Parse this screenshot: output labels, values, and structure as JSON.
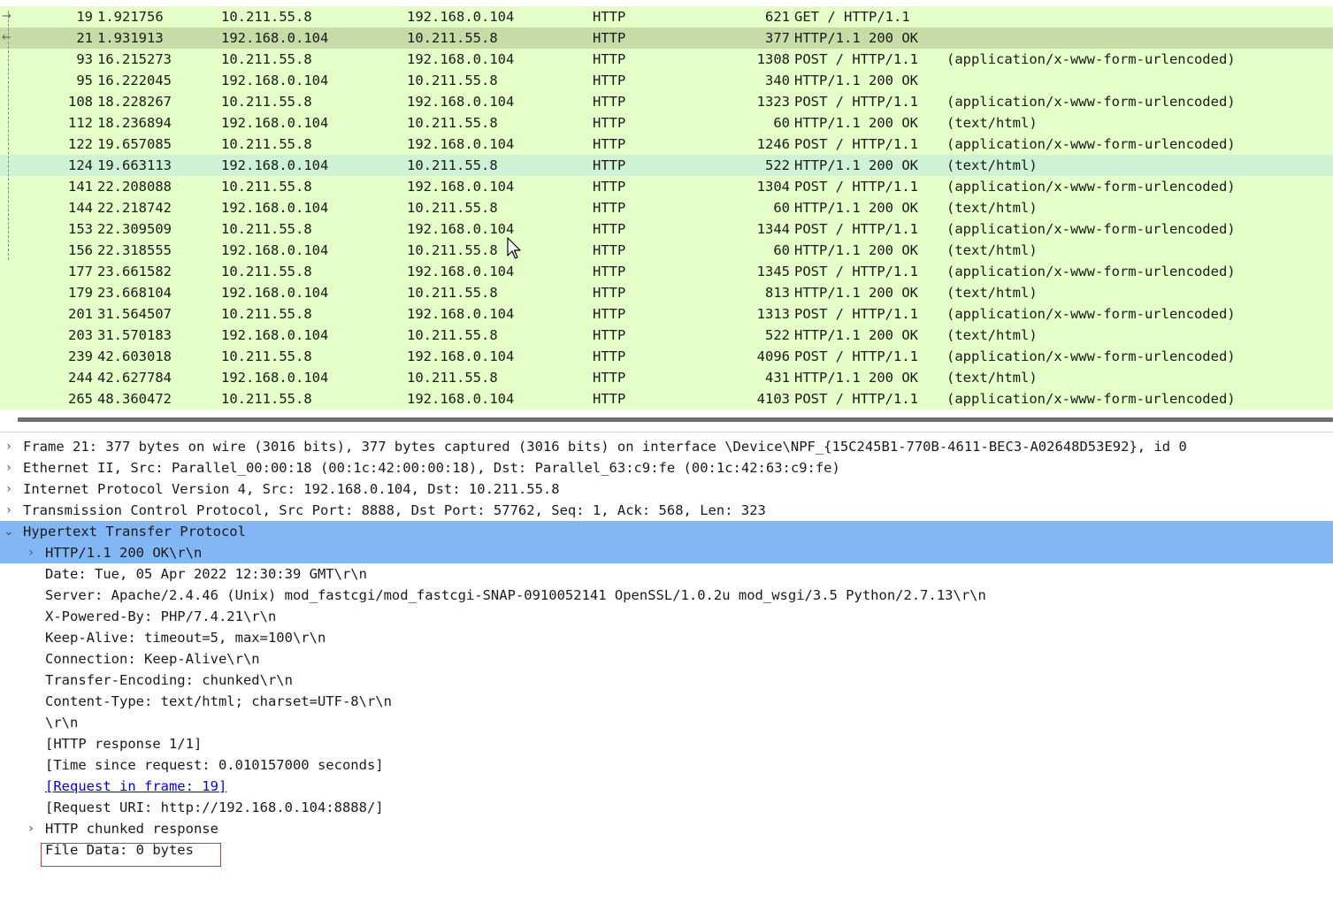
{
  "colors": {
    "row_default": "#e4ffc7",
    "row_selected": "#c6dba6",
    "row_hover": "#cff2d5",
    "detail_selected": "#82b6f4",
    "link": "#0000ee",
    "highlight_box": "#e03030"
  },
  "packet_list": {
    "rows": [
      {
        "no": "19",
        "time": "1.921756",
        "src": "10.211.55.8",
        "dst": "192.168.0.104",
        "proto": "HTTP",
        "len": "621",
        "info": "GET / HTTP/1.1",
        "extra": "",
        "state": "default",
        "arrow": "→"
      },
      {
        "no": "21",
        "time": "1.931913",
        "src": "192.168.0.104",
        "dst": "10.211.55.8",
        "proto": "HTTP",
        "len": "377",
        "info": "HTTP/1.1 200 OK",
        "extra": "",
        "state": "selected",
        "arrow": "←"
      },
      {
        "no": "93",
        "time": "16.215273",
        "src": "10.211.55.8",
        "dst": "192.168.0.104",
        "proto": "HTTP",
        "len": "1308",
        "info": "POST / HTTP/1.1",
        "extra": "(application/x-www-form-urlencoded)",
        "state": "default",
        "arrow": ""
      },
      {
        "no": "95",
        "time": "16.222045",
        "src": "192.168.0.104",
        "dst": "10.211.55.8",
        "proto": "HTTP",
        "len": "340",
        "info": "HTTP/1.1 200 OK",
        "extra": "",
        "state": "default",
        "arrow": ""
      },
      {
        "no": "108",
        "time": "18.228267",
        "src": "10.211.55.8",
        "dst": "192.168.0.104",
        "proto": "HTTP",
        "len": "1323",
        "info": "POST / HTTP/1.1",
        "extra": "(application/x-www-form-urlencoded)",
        "state": "default",
        "arrow": ""
      },
      {
        "no": "112",
        "time": "18.236894",
        "src": "192.168.0.104",
        "dst": "10.211.55.8",
        "proto": "HTTP",
        "len": "60",
        "info": "HTTP/1.1 200 OK",
        "extra": "(text/html)",
        "state": "default",
        "arrow": ""
      },
      {
        "no": "122",
        "time": "19.657085",
        "src": "10.211.55.8",
        "dst": "192.168.0.104",
        "proto": "HTTP",
        "len": "1246",
        "info": "POST / HTTP/1.1",
        "extra": "(application/x-www-form-urlencoded)",
        "state": "default",
        "arrow": ""
      },
      {
        "no": "124",
        "time": "19.663113",
        "src": "192.168.0.104",
        "dst": "10.211.55.8",
        "proto": "HTTP",
        "len": "522",
        "info": "HTTP/1.1 200 OK",
        "extra": "(text/html)",
        "state": "hover",
        "arrow": ""
      },
      {
        "no": "141",
        "time": "22.208088",
        "src": "10.211.55.8",
        "dst": "192.168.0.104",
        "proto": "HTTP",
        "len": "1304",
        "info": "POST / HTTP/1.1",
        "extra": "(application/x-www-form-urlencoded)",
        "state": "default",
        "arrow": ""
      },
      {
        "no": "144",
        "time": "22.218742",
        "src": "192.168.0.104",
        "dst": "10.211.55.8",
        "proto": "HTTP",
        "len": "60",
        "info": "HTTP/1.1 200 OK",
        "extra": "(text/html)",
        "state": "default",
        "arrow": ""
      },
      {
        "no": "153",
        "time": "22.309509",
        "src": "10.211.55.8",
        "dst": "192.168.0.104",
        "proto": "HTTP",
        "len": "1344",
        "info": "POST / HTTP/1.1",
        "extra": "(application/x-www-form-urlencoded)",
        "state": "default",
        "arrow": ""
      },
      {
        "no": "156",
        "time": "22.318555",
        "src": "192.168.0.104",
        "dst": "10.211.55.8",
        "proto": "HTTP",
        "len": "60",
        "info": "HTTP/1.1 200 OK",
        "extra": "(text/html)",
        "state": "default",
        "arrow": ""
      },
      {
        "no": "177",
        "time": "23.661582",
        "src": "10.211.55.8",
        "dst": "192.168.0.104",
        "proto": "HTTP",
        "len": "1345",
        "info": "POST / HTTP/1.1",
        "extra": "(application/x-www-form-urlencoded)",
        "state": "default",
        "arrow": ""
      },
      {
        "no": "179",
        "time": "23.668104",
        "src": "192.168.0.104",
        "dst": "10.211.55.8",
        "proto": "HTTP",
        "len": "813",
        "info": "HTTP/1.1 200 OK",
        "extra": "(text/html)",
        "state": "default",
        "arrow": ""
      },
      {
        "no": "201",
        "time": "31.564507",
        "src": "10.211.55.8",
        "dst": "192.168.0.104",
        "proto": "HTTP",
        "len": "1313",
        "info": "POST / HTTP/1.1",
        "extra": "(application/x-www-form-urlencoded)",
        "state": "default",
        "arrow": ""
      },
      {
        "no": "203",
        "time": "31.570183",
        "src": "192.168.0.104",
        "dst": "10.211.55.8",
        "proto": "HTTP",
        "len": "522",
        "info": "HTTP/1.1 200 OK",
        "extra": "(text/html)",
        "state": "default",
        "arrow": ""
      },
      {
        "no": "239",
        "time": "42.603018",
        "src": "10.211.55.8",
        "dst": "192.168.0.104",
        "proto": "HTTP",
        "len": "4096",
        "info": "POST / HTTP/1.1",
        "extra": "(application/x-www-form-urlencoded)",
        "state": "default",
        "arrow": ""
      },
      {
        "no": "244",
        "time": "42.627784",
        "src": "192.168.0.104",
        "dst": "10.211.55.8",
        "proto": "HTTP",
        "len": "431",
        "info": "HTTP/1.1 200 OK",
        "extra": "(text/html)",
        "state": "default",
        "arrow": ""
      },
      {
        "no": "265",
        "time": "48.360472",
        "src": "10.211.55.8",
        "dst": "192.168.0.104",
        "proto": "HTTP",
        "len": "4103",
        "info": "POST / HTTP/1.1",
        "extra": "(application/x-www-form-urlencoded)",
        "state": "default",
        "arrow": ""
      }
    ]
  },
  "details": {
    "frame": {
      "chevron": "›",
      "text": "Frame 21: 377 bytes on wire (3016 bits), 377 bytes captured (3016 bits) on interface \\Device\\NPF_{15C245B1-770B-4611-BEC3-A02648D53E92}, id 0"
    },
    "ethernet": {
      "chevron": "›",
      "text": "Ethernet II, Src: Parallel_00:00:18 (00:1c:42:00:00:18), Dst: Parallel_63:c9:fe (00:1c:42:63:c9:fe)"
    },
    "ip": {
      "chevron": "›",
      "text": "Internet Protocol Version 4, Src: 192.168.0.104, Dst: 10.211.55.8"
    },
    "tcp": {
      "chevron": "›",
      "text": "Transmission Control Protocol, Src Port: 8888, Dst Port: 57762, Seq: 1, Ack: 568, Len: 323"
    },
    "http": {
      "chevron": "⌄",
      "text": "Hypertext Transfer Protocol"
    },
    "status_line": {
      "chevron": "›",
      "text": "HTTP/1.1 200 OK\\r\\n"
    },
    "date": "Date: Tue, 05 Apr 2022 12:30:39 GMT\\r\\n",
    "server": "Server: Apache/2.4.46 (Unix) mod_fastcgi/mod_fastcgi-SNAP-0910052141 OpenSSL/1.0.2u mod_wsgi/3.5 Python/2.7.13\\r\\n",
    "x_powered_by": "X-Powered-By: PHP/7.4.21\\r\\n",
    "keep_alive": "Keep-Alive: timeout=5, max=100\\r\\n",
    "connection": "Connection: Keep-Alive\\r\\n",
    "transfer_encoding": "Transfer-Encoding: chunked\\r\\n",
    "content_type": "Content-Type: text/html; charset=UTF-8\\r\\n",
    "crlf": "\\r\\n",
    "response_num": "[HTTP response 1/1]",
    "time_since": "[Time since request: 0.010157000 seconds]",
    "request_in_frame": "[Request in frame: 19]",
    "request_uri": "[Request URI: http://192.168.0.104:8888/]",
    "chunked": {
      "chevron": "›",
      "text": "HTTP chunked response"
    },
    "file_data": "File Data: 0 bytes"
  }
}
